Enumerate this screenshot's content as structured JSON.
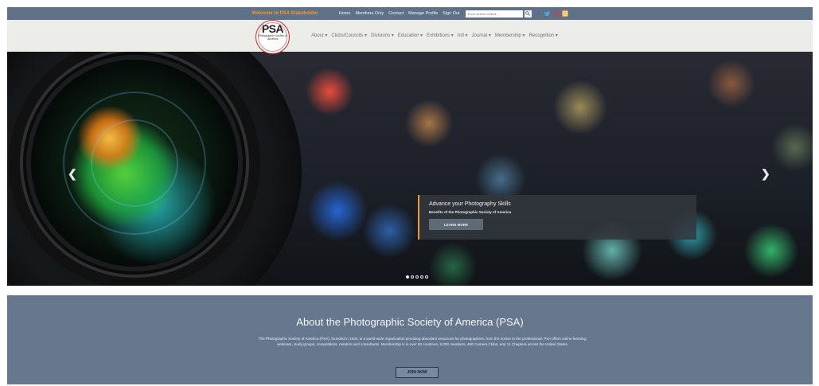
{
  "topbar": {
    "welcome": "Welcome to PSA Stakeholder",
    "links": [
      "Home",
      "Members Only",
      "Contact",
      "Manage Profile",
      "Sign Out"
    ],
    "search_placeholder": "Enter search criteria...",
    "social": [
      "facebook-icon",
      "twitter-icon",
      "pinterest-icon",
      "instagram-icon"
    ]
  },
  "logo": {
    "mark": "PSA",
    "subtitle": "Photographic Society of America"
  },
  "nav": {
    "items": [
      "About ▾",
      "Clubs/Councils ▾",
      "Divisions ▾",
      "Education ▾",
      "Exhibitions ▾",
      "Intl ▾",
      "Journal ▾",
      "Membership ▾",
      "Recognition ▾"
    ]
  },
  "hero": {
    "caption_title": "Advance your Photography Skills",
    "caption_subtitle": "Benefits of the Photographic Society of America",
    "caption_button": "LEARN MORE",
    "slide_count": 5,
    "active_slide": 1
  },
  "about": {
    "title": "About the Photographic Society of America (PSA)",
    "body": "The Photographic Society of America (PSA), founded in 1934, is a world-wide organization providing abundant resources for photographers, from the novice to the professional. PSA offers online learning, webinars, study groups, competitions, mentors and consultants. Membership is in over 80 countries, 5,000 members, 460 Camera Clubs, and 11 Chapters across the United States.",
    "button": "JOIN NOW"
  },
  "colors": {
    "topbar": "#5f7187",
    "accent": "#f39a2a",
    "navbar": "#ecece8",
    "about_bg": "#67788e"
  }
}
